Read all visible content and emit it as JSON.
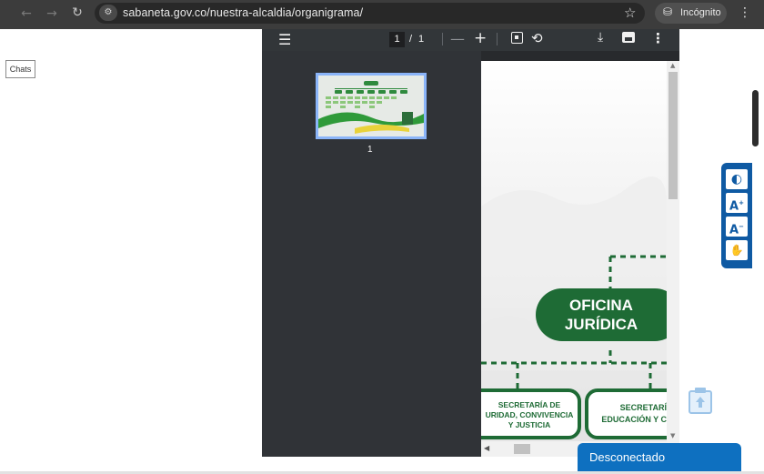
{
  "browser": {
    "url": "sabaneta.gov.co/nuestra-alcaldia/organigrama/",
    "incognito_label": "Incógnito",
    "icons": {
      "back": "back-arrow-icon",
      "forward": "forward-arrow-icon",
      "reload": "reload-icon",
      "site_info": "site-info-icon",
      "bookmark": "star-icon",
      "incognito": "incognito-icon",
      "menu": "more-vert-icon"
    }
  },
  "page": {
    "chats_label": "Chats"
  },
  "pdf_viewer": {
    "current_page": "1",
    "page_separator": "/",
    "total_pages": "1",
    "thumbnail_label": "1",
    "document": {
      "oficina_line1": "OFICINA",
      "oficina_line2": "JURÍDICA",
      "box1_line1": "SECRETARÍA DE",
      "box1_line2": "URIDAD, CONVIVENCIA",
      "box1_line3": "Y JUSTICIA",
      "box2_line1": "SECRETARÍ",
      "box2_line2": "EDUCACIÓN Y C"
    },
    "colors": {
      "toolbar": "#323639",
      "sidebar": "#303337",
      "thumbnail_border": "#8ab4f8",
      "org_green": "#1e6b35"
    }
  },
  "accessibility": {
    "buttons": [
      {
        "name": "contrast-icon",
        "symbol": "◐"
      },
      {
        "name": "increase-font-icon",
        "symbol": "A+"
      },
      {
        "name": "decrease-font-icon",
        "symbol": "A-"
      },
      {
        "name": "sign-language-icon",
        "symbol": "✋"
      }
    ],
    "color": "#0f5aa3"
  },
  "chat_status": {
    "label": "Desconectado",
    "color": "#0e70c0"
  }
}
